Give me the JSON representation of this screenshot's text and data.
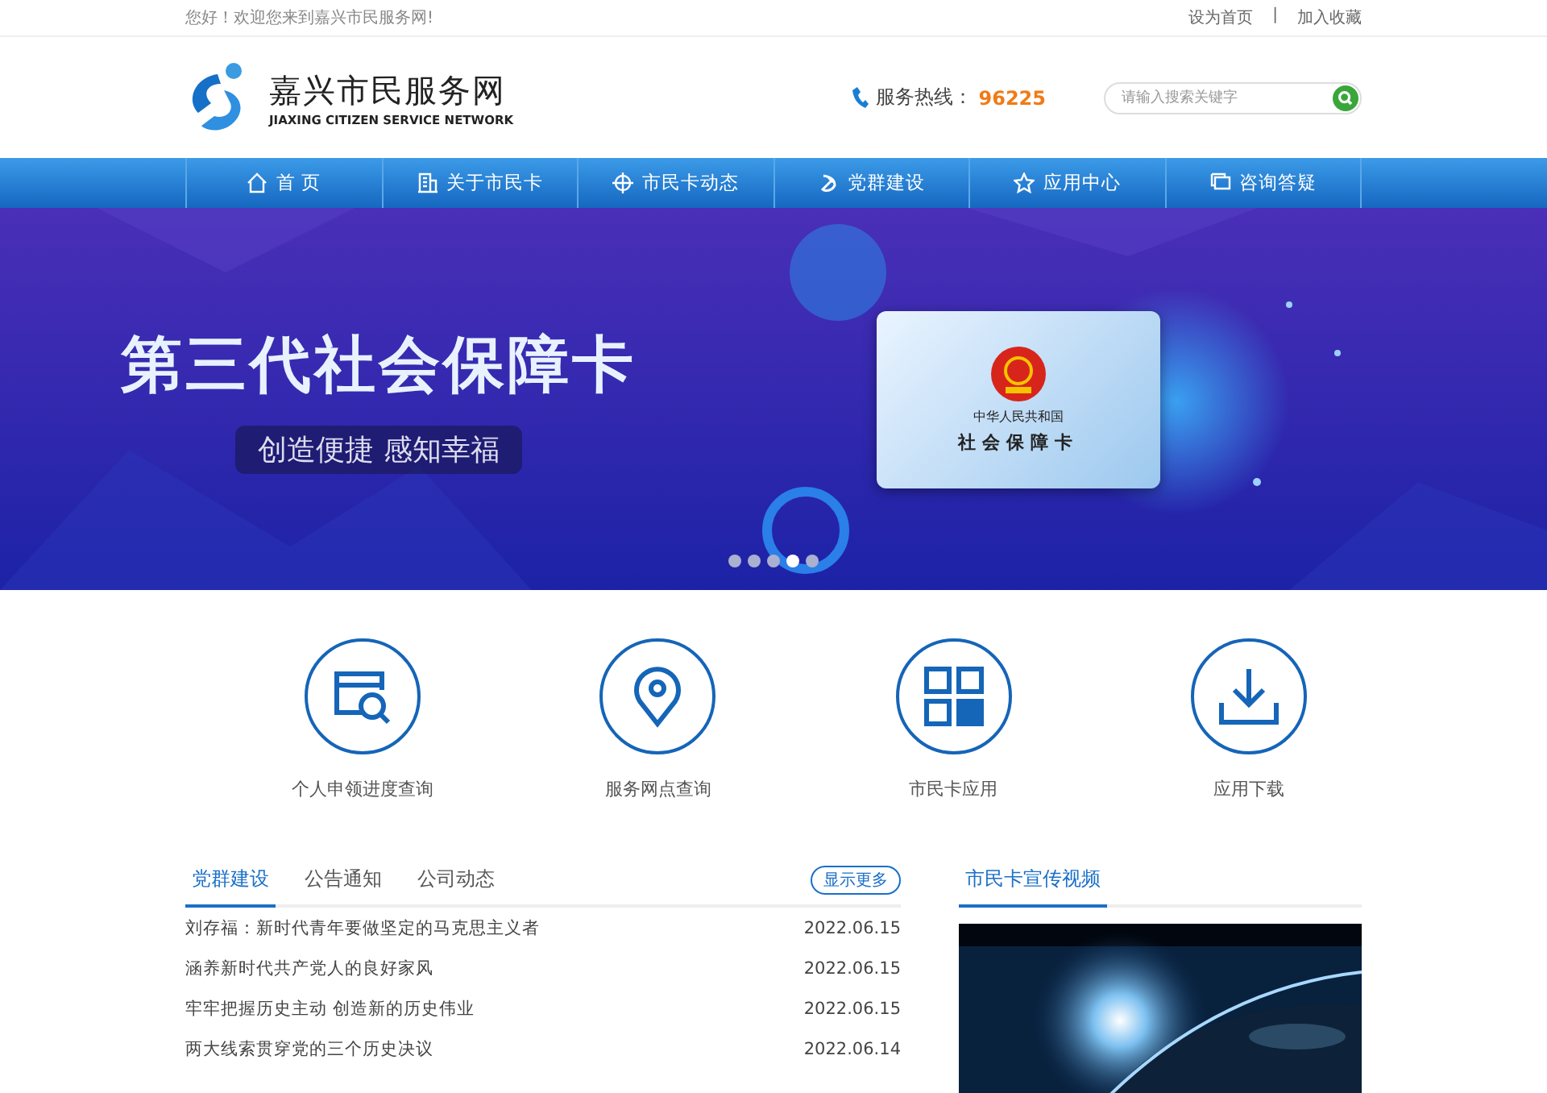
{
  "top_bar": {
    "welcome": "您好！欢迎您来到嘉兴市民服务网!",
    "links": [
      "设为首页",
      "加入收藏"
    ],
    "separator": "|"
  },
  "header": {
    "logo_title": "嘉兴市民服务网",
    "logo_subtitle": "JIAXING CITIZEN SERVICE NETWORK",
    "hotline_label": "服务热线：",
    "hotline_number": "96225",
    "search": {
      "placeholder": "请输入搜索关键字"
    }
  },
  "nav": [
    {
      "label": "首 页",
      "kind": "home",
      "selected": false
    },
    {
      "label": "关于市民卡",
      "kind": "building",
      "selected": false
    },
    {
      "label": "市民卡动态",
      "kind": "target",
      "selected": false
    },
    {
      "label": "党群建设",
      "kind": "party",
      "selected": false
    },
    {
      "label": "应用中心",
      "kind": "star",
      "selected": false
    },
    {
      "label": "咨询答疑",
      "kind": "chat",
      "selected": false
    }
  ],
  "banner": {
    "title": "第三代社会保障卡",
    "slogan": "创造便捷 感知幸福",
    "card_country": "中华人民共和国",
    "card_name": "社会保障卡",
    "dots": [
      {
        "selected": false
      },
      {
        "selected": false
      },
      {
        "selected": false
      },
      {
        "selected": true
      },
      {
        "selected": false
      }
    ]
  },
  "services": [
    {
      "label": "个人申领进度查询",
      "kind": "search"
    },
    {
      "label": "服务网点查询",
      "kind": "pin"
    },
    {
      "label": "市民卡应用",
      "kind": "grid"
    },
    {
      "label": "应用下载",
      "kind": "download"
    }
  ],
  "news": {
    "tabs": [
      {
        "label": "党群建设",
        "selected": true
      },
      {
        "label": "公告通知",
        "selected": false
      },
      {
        "label": "公司动态",
        "selected": false
      }
    ],
    "more": "显示更多",
    "items": [
      {
        "title": "刘存福：新时代青年要做坚定的马克思主义者",
        "date": "2022.06.15"
      },
      {
        "title": "涵养新时代共产党人的良好家风",
        "date": "2022.06.15"
      },
      {
        "title": "牢牢把握历史主动 创造新的历史伟业",
        "date": "2022.06.15"
      },
      {
        "title": "两大线索贯穿党的三个历史决议",
        "date": "2022.06.14"
      }
    ]
  },
  "video": {
    "title": "市民卡宣传视频",
    "kind": "picture"
  }
}
